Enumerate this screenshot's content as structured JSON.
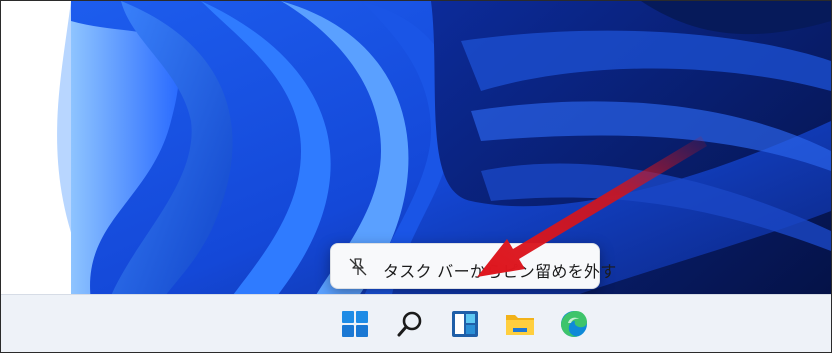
{
  "context_menu": {
    "items": [
      {
        "label": "タスク バーからピン留めを外す",
        "icon": "unpin-icon"
      }
    ]
  },
  "taskbar": {
    "icons": [
      "windows-start-icon",
      "search-icon",
      "widgets-icon",
      "file-explorer-icon",
      "edge-browser-icon"
    ]
  },
  "colors": {
    "taskbar_bg": "#eef2f8",
    "menu_bg": "#f8f9fb",
    "annotation_arrow": "#d0141c",
    "wallpaper_base": "#0a2a8a"
  }
}
